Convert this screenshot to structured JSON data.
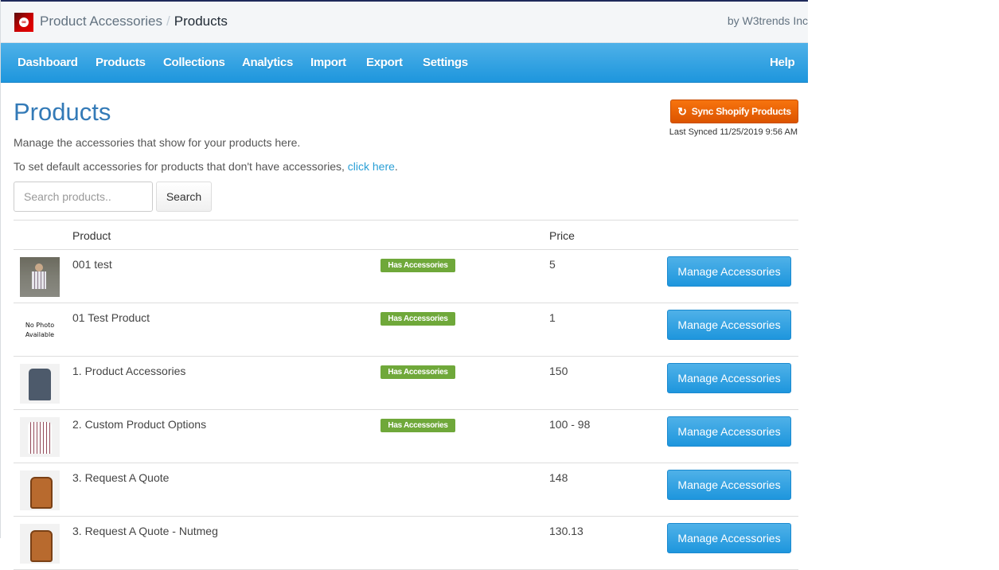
{
  "header": {
    "breadcrumb_parent": "Product Accessories",
    "breadcrumb_separator": "/",
    "breadcrumb_current": "Products",
    "byline": "by W3trends Inc",
    "logo_icon": "chain-link-icon"
  },
  "nav": {
    "items": [
      {
        "label": "Dashboard"
      },
      {
        "label": "Products"
      },
      {
        "label": "Collections"
      },
      {
        "label": "Analytics"
      },
      {
        "label": "Import"
      },
      {
        "label": "Export"
      },
      {
        "label": "Settings"
      }
    ],
    "help_label": "Help"
  },
  "page": {
    "title": "Products",
    "description": "Manage the accessories that show for your products here.",
    "default_text": "To set default accessories for products that don't have accessories, ",
    "default_link": "click here",
    "default_suffix": ".",
    "sync_button": "Sync Shopify Products",
    "sync_icon": "refresh-icon",
    "last_synced": "Last Synced 11/25/2019 9:56 AM"
  },
  "search": {
    "placeholder": "Search products..",
    "value": "",
    "button_label": "Search"
  },
  "table": {
    "headers": {
      "product": "Product",
      "price": "Price"
    },
    "badge_label": "Has Accessories",
    "action_label": "Manage Accessories",
    "no_photo_line1": "No Photo",
    "no_photo_line2": "Available",
    "rows": [
      {
        "name": "001 test",
        "price": "5",
        "has_accessories": true,
        "image": "person-plaid-shirt"
      },
      {
        "name": "01 Test Product",
        "price": "1",
        "has_accessories": true,
        "image": "none"
      },
      {
        "name": "1. Product Accessories",
        "price": "150",
        "has_accessories": true,
        "image": "blue-shirt"
      },
      {
        "name": "2. Custom Product Options",
        "price": "100 - 98",
        "has_accessories": true,
        "image": "plaid-shirt"
      },
      {
        "name": "3. Request A Quote",
        "price": "148",
        "has_accessories": false,
        "image": "leather-backpack"
      },
      {
        "name": "3. Request A Quote - Nutmeg",
        "price": "130.13",
        "has_accessories": false,
        "image": "leather-backpack"
      }
    ]
  },
  "colors": {
    "nav_blue": "#1e96dd",
    "title_blue": "#337ab7",
    "sync_orange": "#dc5400",
    "badge_green": "#6fa83a",
    "link_blue": "#2a9fd6"
  }
}
